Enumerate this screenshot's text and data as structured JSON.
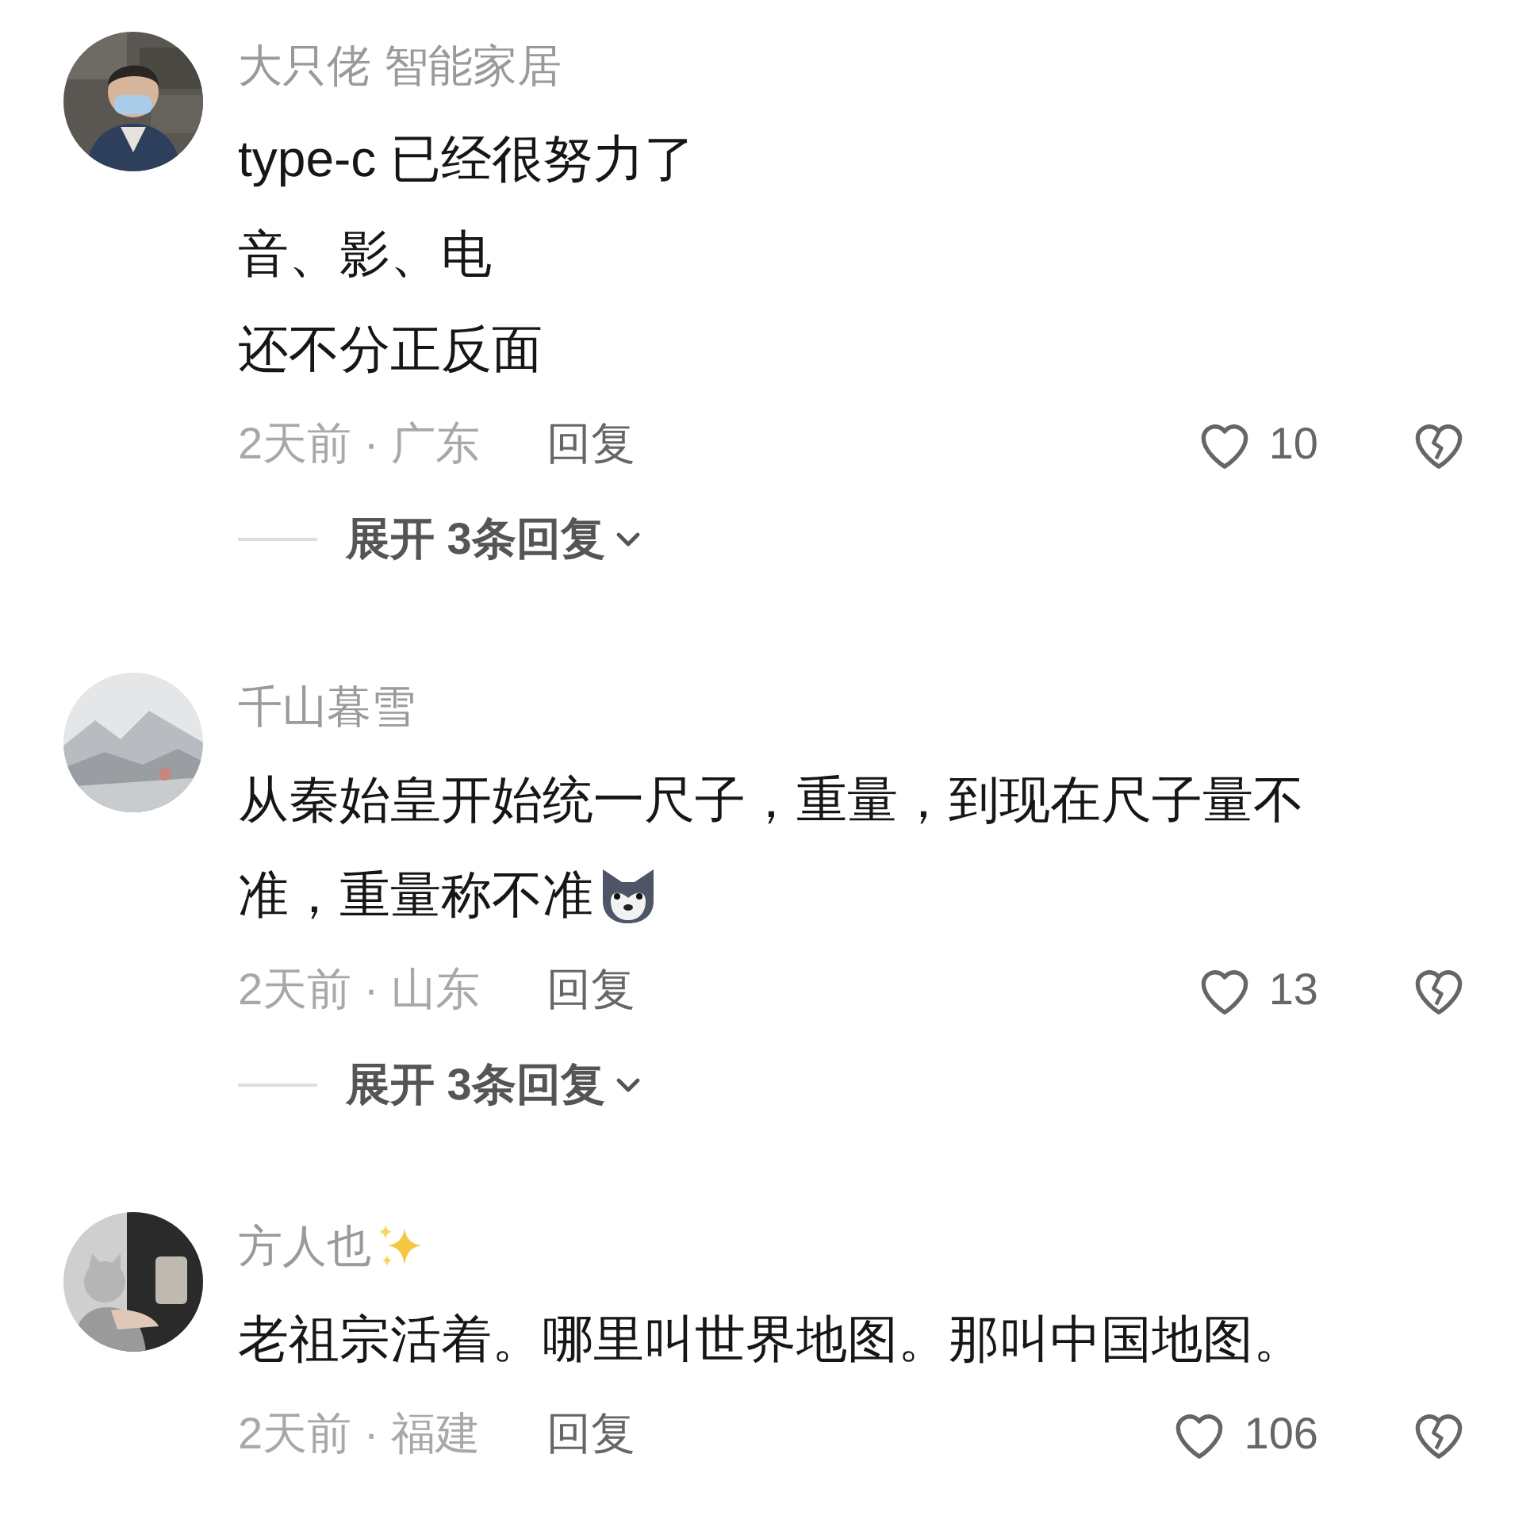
{
  "comments": [
    {
      "username": "大只佬 智能家居",
      "name_sparkles": false,
      "body": [
        "type-c 已经很努力了",
        "音、影、电",
        "还不分正反面"
      ],
      "body_emoji": false,
      "meta": "2天前 · 广东",
      "reply": "回复",
      "likes": "10",
      "liked": false,
      "disliked": false,
      "expand": "展开 3条回复"
    },
    {
      "username": "千山暮雪",
      "name_sparkles": false,
      "body": [
        "从秦始皇开始统一尺子，重量，到现在尺子量不",
        "准，重量称不准"
      ],
      "body_emoji": true,
      "meta": "2天前 · 山东",
      "reply": "回复",
      "likes": "13",
      "liked": false,
      "disliked": false,
      "expand": "展开 3条回复"
    },
    {
      "username": "方人也",
      "name_sparkles": true,
      "body": [
        "老祖宗活着。哪里叫世界地图。那叫中国地图。"
      ],
      "body_emoji": false,
      "meta": "2天前 · 福建",
      "reply": "回复",
      "likes": "106",
      "liked": false,
      "disliked": false
    }
  ]
}
